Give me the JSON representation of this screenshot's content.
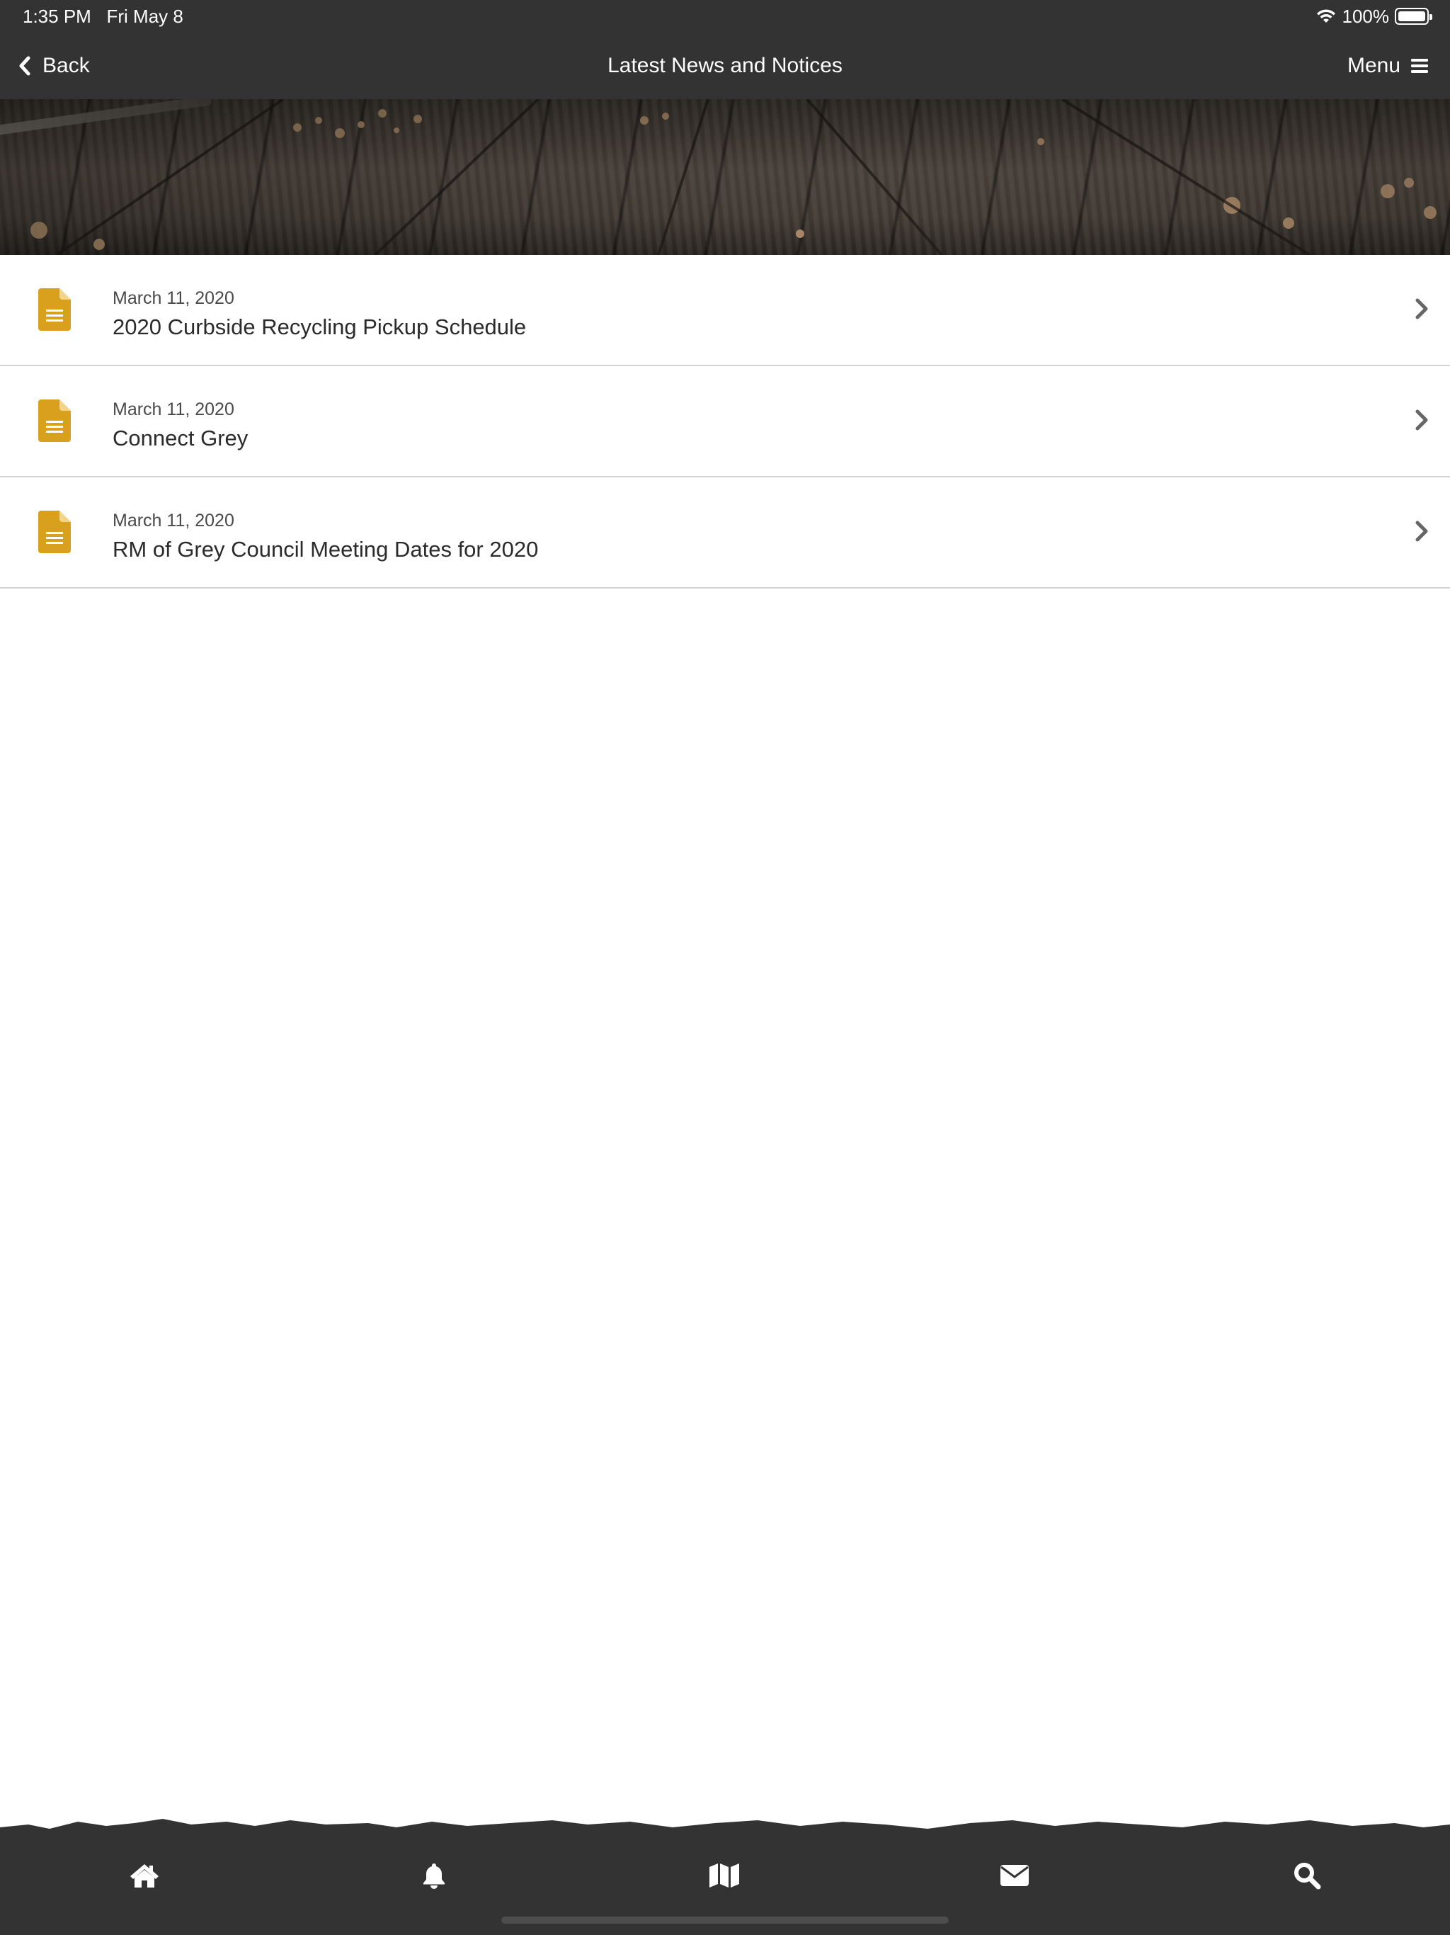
{
  "status_bar": {
    "time": "1:35 PM",
    "date": "Fri May 8",
    "battery": "100%",
    "battery_level": 1.0
  },
  "nav": {
    "back_label": "Back",
    "title": "Latest News and Notices",
    "menu_label": "Menu"
  },
  "news_items": [
    {
      "date": "March 11, 2020",
      "title": "2020 Curbside Recycling Pickup Schedule"
    },
    {
      "date": "March 11, 2020",
      "title": "Connect Grey"
    },
    {
      "date": "March 11, 2020",
      "title": "RM of Grey Council Meeting Dates for 2020"
    }
  ],
  "tabbar": {
    "icons": [
      "home-icon",
      "bell-icon",
      "map-icon",
      "envelope-icon",
      "search-icon"
    ]
  },
  "colors": {
    "bar_background": "#333333",
    "accent_document": "#d9a01e",
    "chevron": "#666666"
  }
}
